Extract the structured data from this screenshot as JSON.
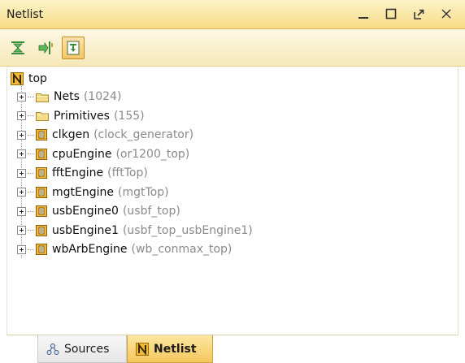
{
  "window": {
    "title": "Netlist"
  },
  "toolbar": {
    "buttons": [
      {
        "icon": "collapse-all-icon"
      },
      {
        "icon": "expand-icon"
      },
      {
        "icon": "show-hierarchy-icon",
        "active": true
      }
    ]
  },
  "tree": {
    "root": {
      "label": "top"
    },
    "items": [
      {
        "label": "Nets",
        "meta": "(1024)",
        "kind": "folder"
      },
      {
        "label": "Primitives",
        "meta": "(155)",
        "kind": "folder"
      },
      {
        "label": "clkgen",
        "meta": "(clock_generator)",
        "kind": "cell"
      },
      {
        "label": "cpuEngine",
        "meta": "(or1200_top)",
        "kind": "cell"
      },
      {
        "label": "fftEngine",
        "meta": "(fftTop)",
        "kind": "cell"
      },
      {
        "label": "mgtEngine",
        "meta": "(mgtTop)",
        "kind": "cell"
      },
      {
        "label": "usbEngine0",
        "meta": "(usbf_top)",
        "kind": "cell"
      },
      {
        "label": "usbEngine1",
        "meta": "(usbf_top_usbEngine1)",
        "kind": "cell"
      },
      {
        "label": "wbArbEngine",
        "meta": "(wb_conmax_top)",
        "kind": "cell"
      }
    ]
  },
  "tabs": [
    {
      "label": "Sources",
      "icon": "sources-icon"
    },
    {
      "label": "Netlist",
      "icon": "netlist-icon",
      "active": true
    }
  ],
  "colors": {
    "titlebar": "#f6dc86",
    "active_tab": "#f4c75d",
    "meta_text": "#8a8a8a"
  }
}
